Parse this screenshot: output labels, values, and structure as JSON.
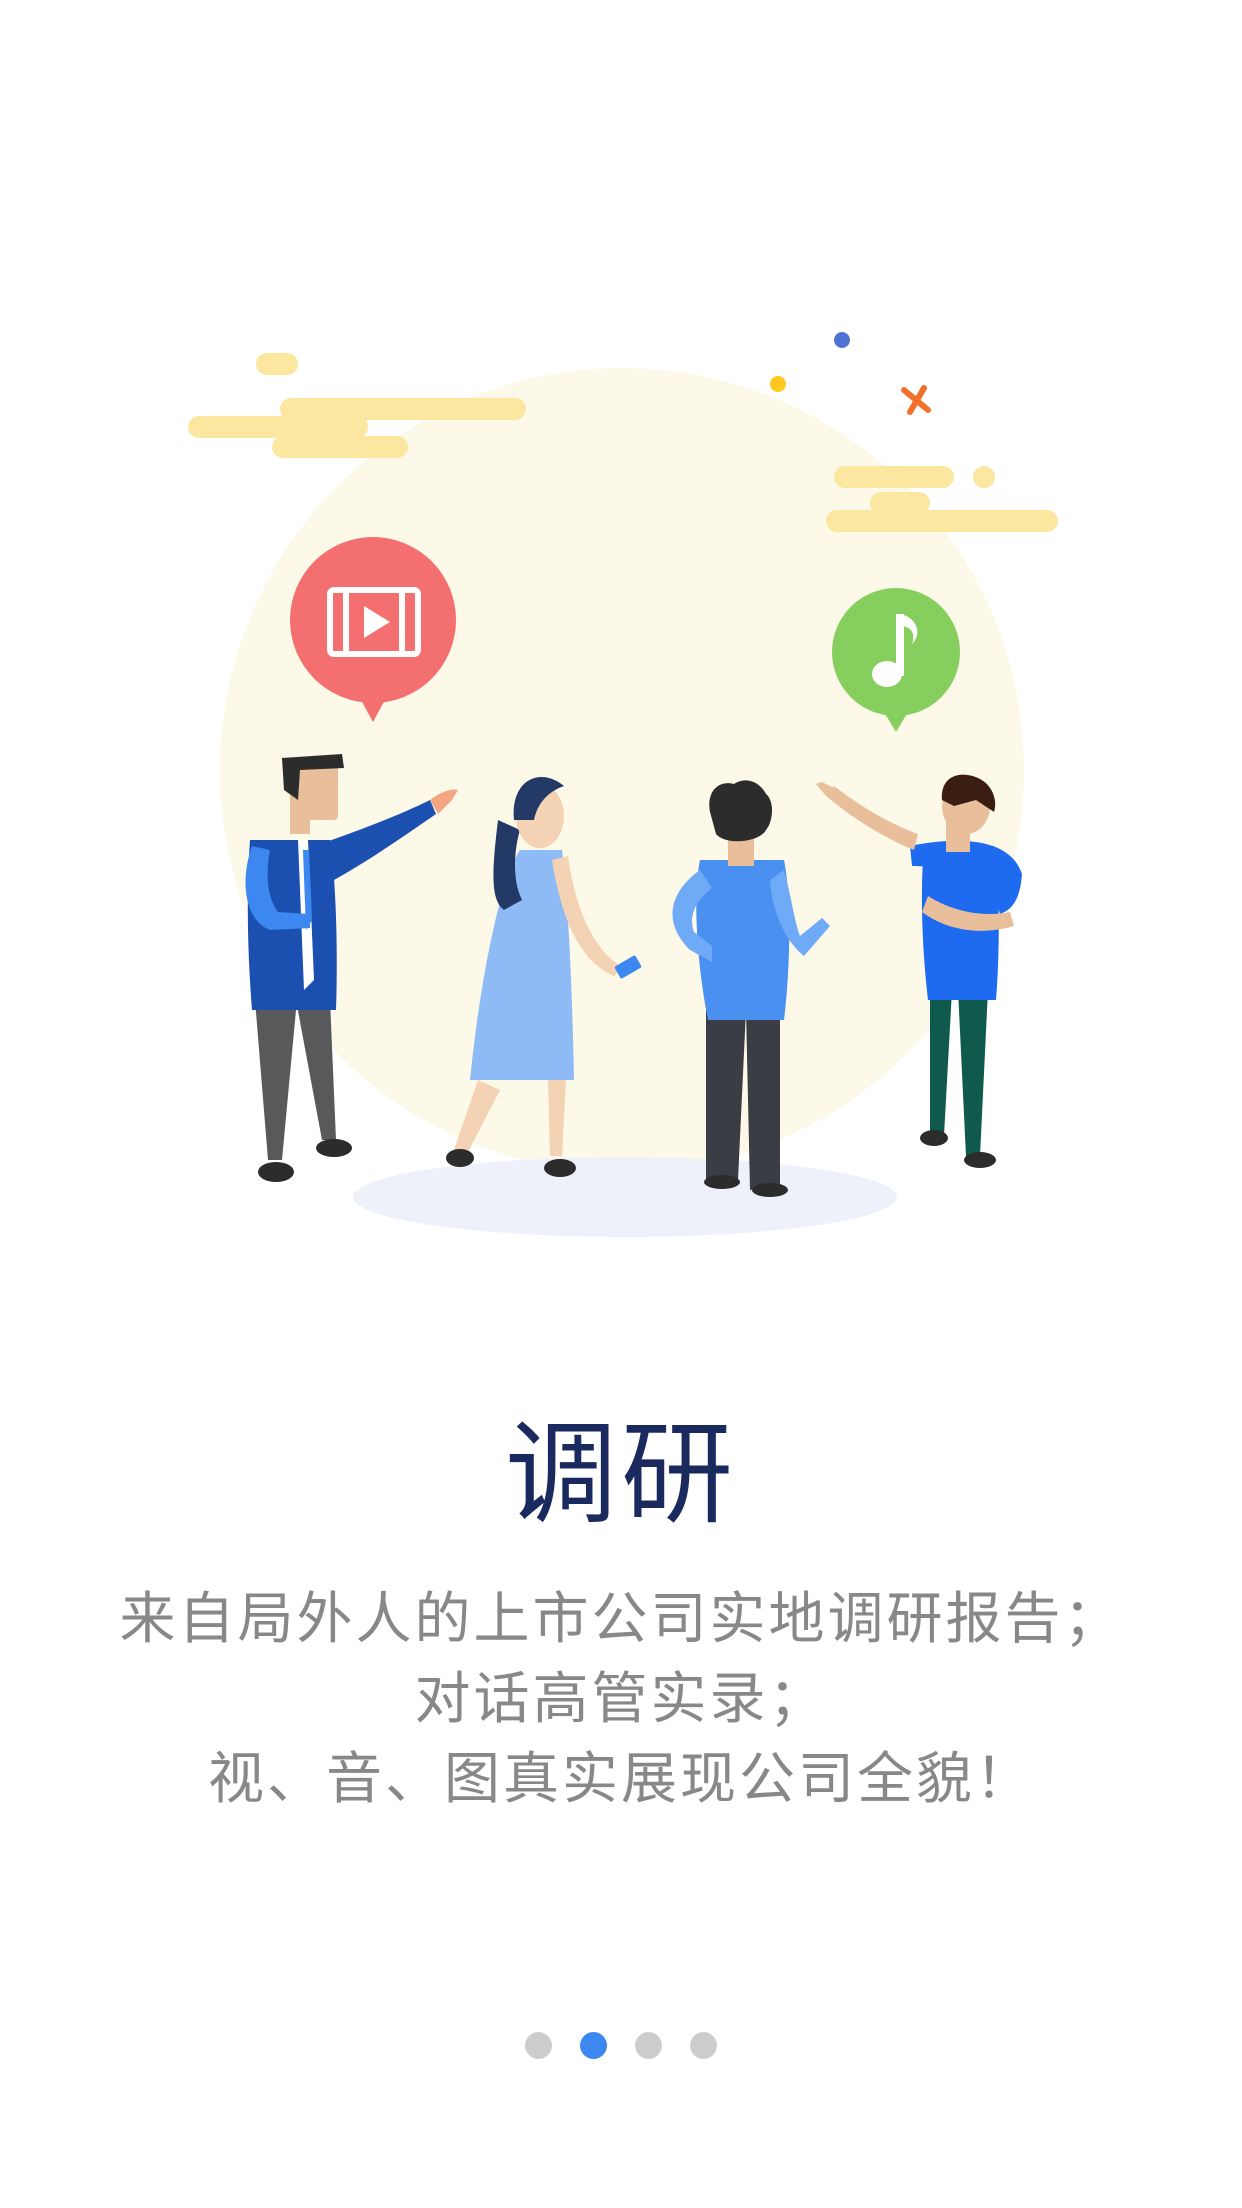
{
  "onboarding": {
    "title": "调研",
    "description_lines": [
      "来自局外人的上市公司实地调研报告；",
      "对话高管实录；",
      "视、音、图真实展现公司全貌！"
    ]
  },
  "pager": {
    "total": 4,
    "active_index": 1
  },
  "icons": {
    "video_bubble": "video-film-icon",
    "music_bubble": "music-note-icon"
  },
  "colors": {
    "title": "#1a2a5e",
    "description": "#888888",
    "dot_active": "#3c87f0",
    "dot_inactive": "#cccccc",
    "video_bubble": "#f46f6f",
    "music_bubble": "#86cf5e",
    "backdrop": "#fdf9e8"
  }
}
